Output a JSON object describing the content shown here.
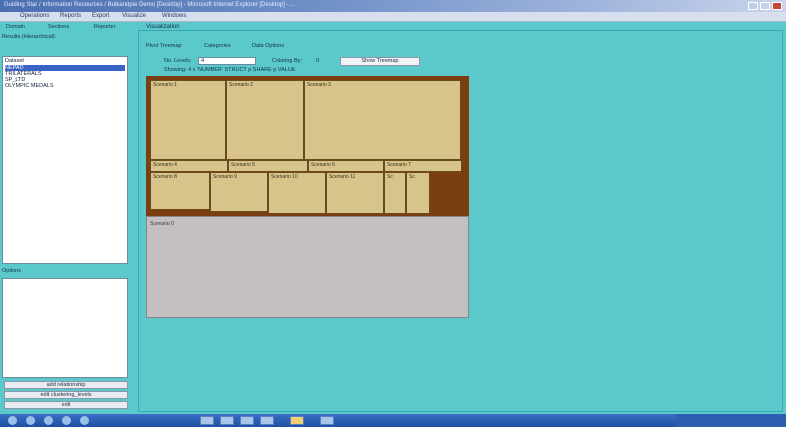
{
  "window": {
    "title": "Guiding Star / Information Resources / Bulkandpie Demo [Desktop] - Microsoft Internet Explorer [Desktop] - ...",
    "menu": [
      "Operations",
      "Reports",
      "Export",
      "Visualize",
      "Windows"
    ]
  },
  "left_panel": {
    "tabs": [
      "Domain",
      "Sections",
      "Reporter"
    ],
    "heading": "Results (Hierarchical):",
    "list_items": [
      {
        "label": "Dataset",
        "selected": false
      },
      {
        "label": "NEPAD",
        "selected": true
      },
      {
        "label": "TRILATERALS",
        "selected": false
      },
      {
        "label": "SP_LTD",
        "selected": false
      },
      {
        "label": "OLYMPIC MEDALS",
        "selected": false
      }
    ],
    "section2_label": "Options",
    "buttons": [
      "add relationship",
      "edit clustering_levels",
      "edit"
    ]
  },
  "main": {
    "tab": "Visualization",
    "subtabs": [
      "Pivot Treemap",
      "Categories",
      "Data Options"
    ],
    "ctl_no_levels_label": "No. Levels:",
    "ctl_no_levels_value": "4",
    "ctl_coloring_label": "Coloring By:",
    "ctl_coloring_value": "0",
    "action_button": "Show Treemap",
    "caption": "Showing: 4 x 'NUMBER' STRUCT p SHARE p VALUE"
  },
  "treemap": {
    "cells": [
      {
        "label": "Scenario 1"
      },
      {
        "label": "Scenario 2"
      },
      {
        "label": "Scenario 3"
      },
      {
        "label": "Scenario 4"
      },
      {
        "label": "Scenario 5"
      },
      {
        "label": "Scenario 6"
      },
      {
        "label": "Scenario 7"
      },
      {
        "label": "Scenario 8"
      },
      {
        "label": "Scenario 9"
      },
      {
        "label": "Scenario 10"
      },
      {
        "label": "Scenario 11"
      },
      {
        "label": "Sc"
      },
      {
        "label": "Sc"
      }
    ],
    "gray_label": "Scenario 0",
    "colors": {
      "frame": "#7b3e10",
      "cell": "#d6c48a",
      "empty": "#c4c0c2"
    }
  },
  "taskbar": {
    "items": [
      "start"
    ]
  }
}
